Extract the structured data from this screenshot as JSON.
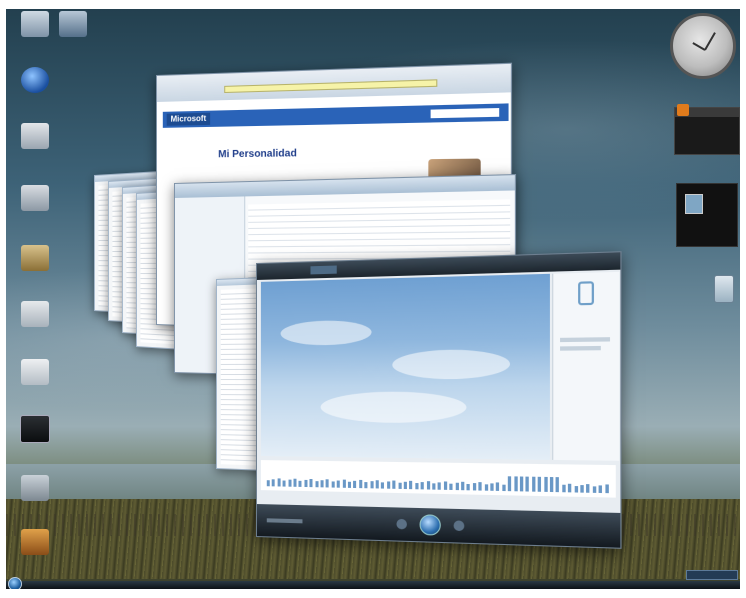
{
  "desktop": {
    "icons": [
      {
        "name": "computer-icon"
      },
      {
        "name": "network-icon"
      },
      {
        "name": "browser-shortcut-icon"
      },
      {
        "name": "documents-icon"
      },
      {
        "name": "folder-icon"
      },
      {
        "name": "file-icon"
      },
      {
        "name": "document-icon"
      },
      {
        "name": "display-icon"
      },
      {
        "name": "drive-icon"
      },
      {
        "name": "stack-icon"
      }
    ]
  },
  "sidebar": {
    "gadgets": [
      "clock-gadget",
      "feed-gadget",
      "slideshow-gadget"
    ]
  },
  "browser": {
    "brand": "Microsoft",
    "heading": "Mi Personalidad"
  },
  "colors": {
    "brand_bar": "#2a63b8",
    "taskbar": "#0d1216",
    "sky": "#3d6277"
  }
}
